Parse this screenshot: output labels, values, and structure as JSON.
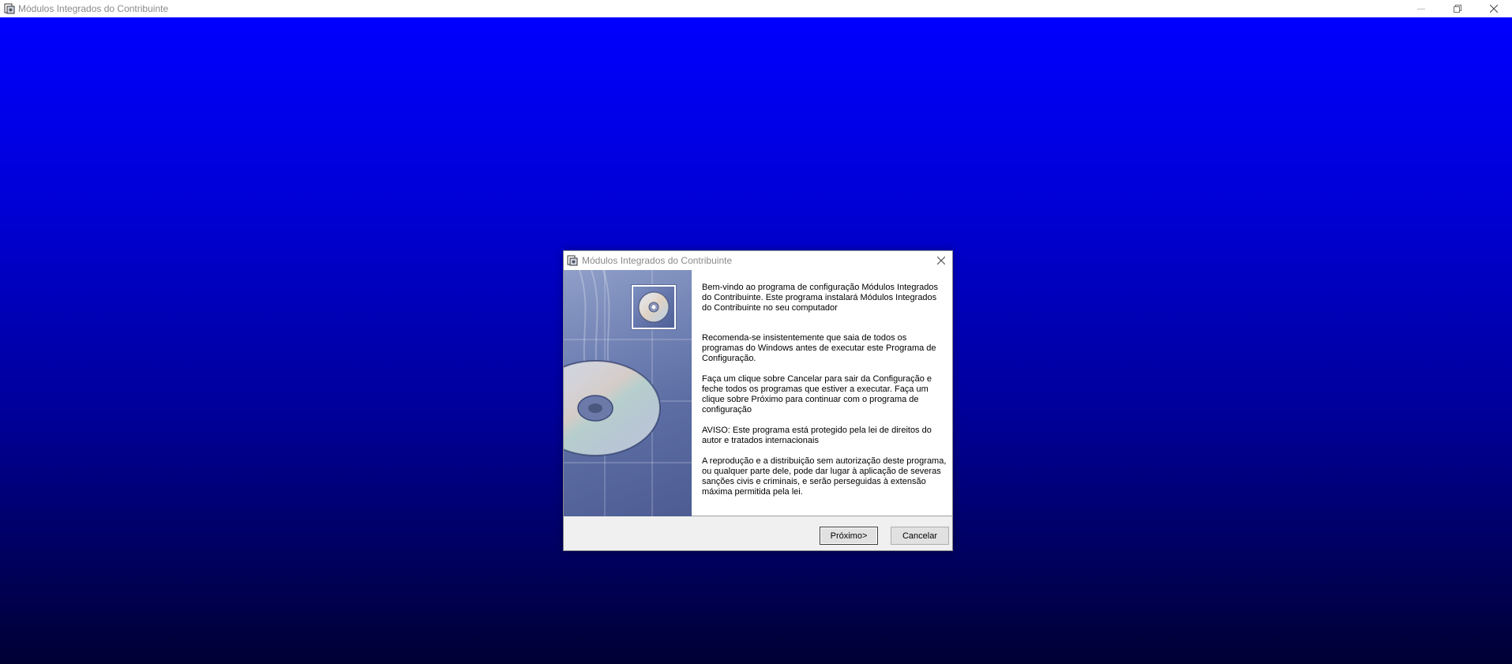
{
  "app": {
    "title": "Módulos Integrados do Contribuinte"
  },
  "dialog": {
    "title": "Módulos Integrados do Contribuinte",
    "paragraphs": [
      "Bem-vindo ao programa de configuração Módulos Integrados do Contribuinte. Este programa instalará Módulos Integrados do Contribuinte no seu computador",
      "Recomenda-se insistentemente que saia de todos os programas do Windows antes de executar este Programa de Configuração.",
      "Faça um clique sobre Cancelar para sair da Configuração e feche todos os programas que estiver a executar. Faça um clique sobre Próximo para continuar com o programa de configuração",
      "AVISO: Este programa está protegido pela lei de direitos do autor e tratados internacionais",
      "A reprodução e a distribuição sem autorização deste programa, ou qualquer parte dele, pode dar lugar à aplicação de severas sanções civis e criminais, e serão perseguidas à extensão máxima permitida pela lei."
    ],
    "buttons": {
      "next": "Próximo>",
      "cancel": "Cancelar"
    }
  },
  "icons": {
    "app": "installer-icon",
    "minimize": "minimize-icon",
    "restore": "restore-icon",
    "close": "close-icon",
    "cd": "cd-disc-icon"
  },
  "colors": {
    "desktop_top": "#0000ff",
    "desktop_bottom": "#000033",
    "sidebar_blue": "#6f80b3"
  }
}
